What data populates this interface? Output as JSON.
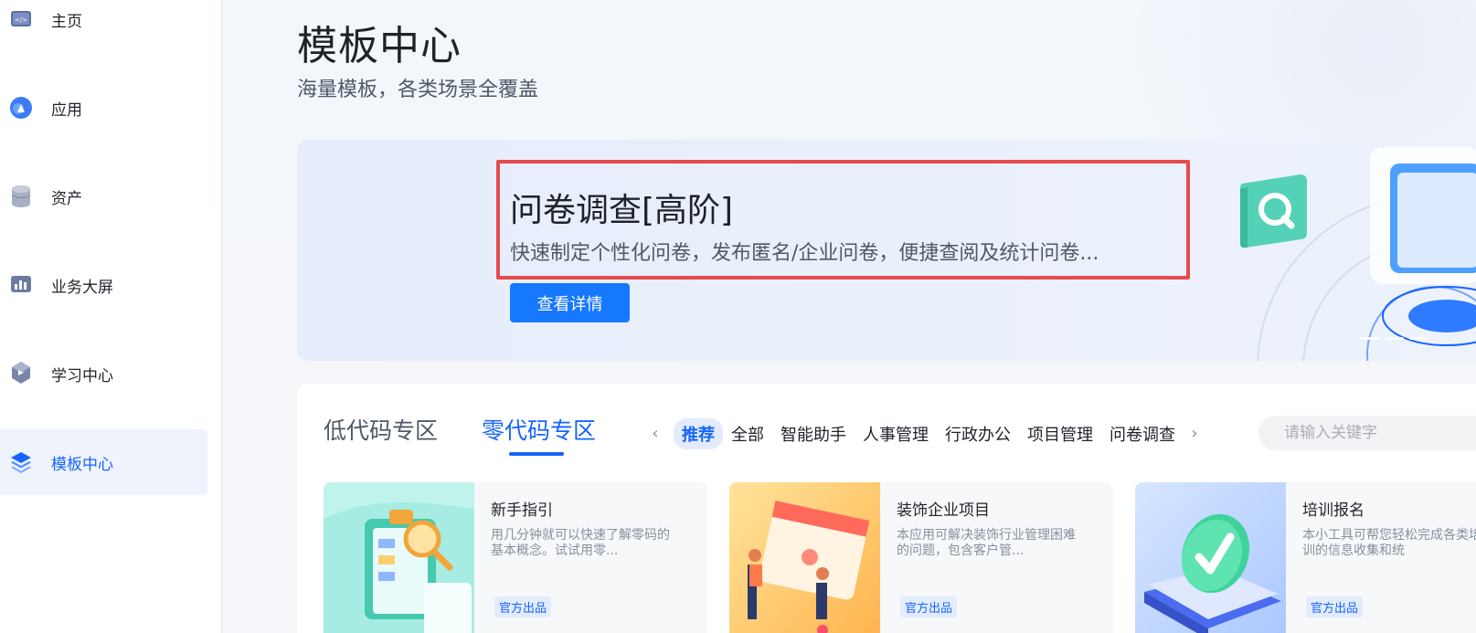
{
  "sidebar": {
    "items": [
      {
        "label": "主页",
        "icon": "code-window-icon"
      },
      {
        "label": "应用",
        "icon": "app-cloud-icon"
      },
      {
        "label": "资产",
        "icon": "database-icon"
      },
      {
        "label": "业务大屏",
        "icon": "bar-screen-icon"
      },
      {
        "label": "学习中心",
        "icon": "graduation-icon"
      },
      {
        "label": "模板中心",
        "icon": "layers-icon",
        "active": true
      }
    ]
  },
  "header": {
    "title": "模板中心",
    "subtitle": "海量模板，各类场景全覆盖"
  },
  "banner": {
    "title": "问卷调查[高阶]",
    "description": "快速制定个性化问卷，发布匿名/企业问卷，便捷查阅及统计问卷...",
    "button_label": "查看详情"
  },
  "zones": {
    "tabs": [
      {
        "label": "低代码专区"
      },
      {
        "label": "零代码专区",
        "active": true
      }
    ]
  },
  "categories": {
    "prev_glyph": "‹",
    "next_glyph": "›",
    "items": [
      "推荐",
      "全部",
      "智能助手",
      "人事管理",
      "行政办公",
      "项目管理",
      "问卷调查"
    ],
    "active": "推荐"
  },
  "search": {
    "placeholder": "请输入关键字"
  },
  "templates": [
    {
      "name": "新手指引",
      "description": "用几分钟就可以快速了解零码的基本概念。试试用零...",
      "badge": "官方出品"
    },
    {
      "name": "装饰企业项目",
      "description": "本应用可解决装饰行业管理困难的问题，包含客户管...",
      "badge": "官方出品"
    },
    {
      "name": "培训报名",
      "description": "本小工具可帮您轻松完成各类培训的信息收集和统",
      "badge": "官方出品"
    }
  ],
  "colors": {
    "accent": "#1664ff",
    "button": "#1677ff",
    "highlight_border": "#e54b4f"
  }
}
